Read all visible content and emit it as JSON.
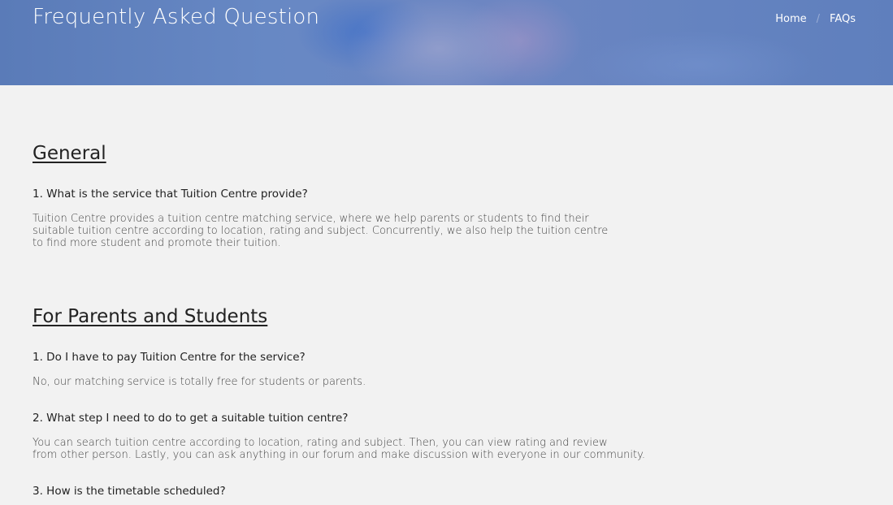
{
  "banner": {
    "title": "Frequently Asked Question",
    "breadcrumb": {
      "home": "Home",
      "separator": "/",
      "current": "FAQs"
    }
  },
  "sections": [
    {
      "heading": "General",
      "items": [
        {
          "question": "1. What is the service that Tuition Centre provide?",
          "answer_lines": [
            "Tuition Centre provides a tuition centre matching service, where we help parents or students to find their",
            "suitable tuition centre according to location, rating and subject. Concurrently, we also help the tuition centre",
            "to find more student and promote their tuition."
          ]
        }
      ]
    },
    {
      "heading": "For Parents and Students",
      "items": [
        {
          "question": "1. Do I have to pay Tuition Centre for the service?",
          "answer_lines": [
            "No, our matching service is totally free for students or parents."
          ]
        },
        {
          "question": "2. What step I need to do to get a suitable tuition centre?",
          "answer_lines": [
            "You can search tuition centre according to location, rating and subject. Then, you can view rating and review",
            "from other person. Lastly, you can ask anything in our forum and make discussion with everyone in our community."
          ]
        },
        {
          "question": "3. How is the timetable scheduled?",
          "answer_lines": []
        }
      ]
    }
  ]
}
